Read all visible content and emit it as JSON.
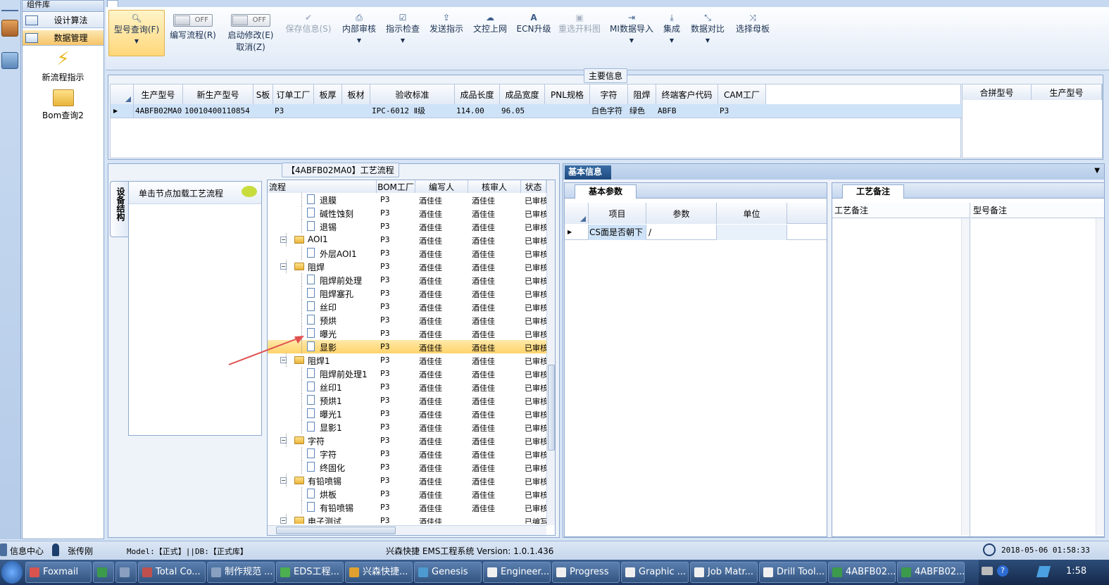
{
  "nav": {
    "top_label": "组件库",
    "items": [
      {
        "label": "设计算法"
      },
      {
        "label": "数据管理"
      }
    ],
    "big_items": [
      {
        "label": "新流程指示",
        "icon": "lightning-icon"
      },
      {
        "label": "Bom查询2",
        "icon": "folder-open-icon"
      }
    ]
  },
  "ribbon": {
    "buttons": [
      {
        "label": "型号查询(F)",
        "icon": "search-icon"
      },
      {
        "label": "编写流程(R)",
        "toggle": "OFF"
      },
      {
        "label": "启动修改(E)",
        "label2": "取消(Z)",
        "toggle": "OFF"
      },
      {
        "label": "保存信息(S)",
        "icon": "check-icon"
      },
      {
        "label": "内部审核",
        "icon": "printer-icon"
      },
      {
        "label": "指示检查",
        "icon": "checkbox-icon"
      },
      {
        "label": "发送指示",
        "icon": "upload-icon"
      },
      {
        "label": "文控上网",
        "icon": "cloud-upload-icon"
      },
      {
        "label": "ECN升级",
        "icon": "font-icon"
      },
      {
        "label": "重选开料图",
        "icon": "image-icon"
      },
      {
        "label": "MI数据导入",
        "icon": "sign-in-icon"
      },
      {
        "label": "集成",
        "icon": "download-icon"
      },
      {
        "label": "数据对比",
        "icon": "compress-icon"
      },
      {
        "label": "选择母板",
        "icon": "shuffle-icon"
      }
    ]
  },
  "main_info": {
    "title": "主要信息",
    "columns": [
      "生产型号",
      "新生产型号",
      "S板",
      "订单工厂",
      "板厚",
      "板材",
      "验收标准",
      "成品长度",
      "成品宽度",
      "PNL规格",
      "字符",
      "阻焊",
      "终端客户代码",
      "CAM工厂"
    ],
    "row": [
      "4ABFB02MA0",
      "10010400110854",
      "",
      "P3",
      "",
      "",
      "IPC-6012 Ⅱ级",
      "114.00",
      "96.05",
      "",
      "白色字符",
      "绿色",
      "ABFB",
      "P3"
    ],
    "side_columns": [
      "合拼型号",
      "生产型号"
    ]
  },
  "process": {
    "title": "【4ABFB02MA0】工艺流程",
    "vtab": "设备结构",
    "hint": "单击节点加载工艺流程",
    "columns": [
      "流程",
      "BOM工厂",
      "编写人",
      "核审人",
      "状态"
    ],
    "rows": [
      {
        "name": "退膜",
        "level": 2,
        "type": "file",
        "bom": "P3",
        "writer": "酒佳佳",
        "reviewer": "酒佳佳",
        "status": "已审核"
      },
      {
        "name": "碱性蚀刻",
        "level": 2,
        "type": "file",
        "bom": "P3",
        "writer": "酒佳佳",
        "reviewer": "酒佳佳",
        "status": "已审核"
      },
      {
        "name": "退锡",
        "level": 2,
        "type": "file",
        "bom": "P3",
        "writer": "酒佳佳",
        "reviewer": "酒佳佳",
        "status": "已审核"
      },
      {
        "name": "AOI1",
        "level": 1,
        "type": "folder",
        "bom": "P3",
        "writer": "酒佳佳",
        "reviewer": "酒佳佳",
        "status": "已审核"
      },
      {
        "name": "外层AOI1",
        "level": 2,
        "type": "file",
        "bom": "P3",
        "writer": "酒佳佳",
        "reviewer": "酒佳佳",
        "status": "已审核"
      },
      {
        "name": "阻焊",
        "level": 1,
        "type": "folder",
        "bom": "P3",
        "writer": "酒佳佳",
        "reviewer": "酒佳佳",
        "status": "已审核"
      },
      {
        "name": "阻焊前处理",
        "level": 2,
        "type": "file",
        "bom": "P3",
        "writer": "酒佳佳",
        "reviewer": "酒佳佳",
        "status": "已审核"
      },
      {
        "name": "阻焊塞孔",
        "level": 2,
        "type": "file",
        "bom": "P3",
        "writer": "酒佳佳",
        "reviewer": "酒佳佳",
        "status": "已审核"
      },
      {
        "name": "丝印",
        "level": 2,
        "type": "file",
        "bom": "P3",
        "writer": "酒佳佳",
        "reviewer": "酒佳佳",
        "status": "已审核"
      },
      {
        "name": "预烘",
        "level": 2,
        "type": "file",
        "bom": "P3",
        "writer": "酒佳佳",
        "reviewer": "酒佳佳",
        "status": "已审核"
      },
      {
        "name": "曝光",
        "level": 2,
        "type": "file",
        "bom": "P3",
        "writer": "酒佳佳",
        "reviewer": "酒佳佳",
        "status": "已审核"
      },
      {
        "name": "显影",
        "level": 2,
        "type": "file",
        "bom": "P3",
        "writer": "酒佳佳",
        "reviewer": "酒佳佳",
        "status": "已审核",
        "selected": true
      },
      {
        "name": "阻焊1",
        "level": 1,
        "type": "folder",
        "bom": "P3",
        "writer": "酒佳佳",
        "reviewer": "酒佳佳",
        "status": "已审核"
      },
      {
        "name": "阻焊前处理1",
        "level": 2,
        "type": "file",
        "bom": "P3",
        "writer": "酒佳佳",
        "reviewer": "酒佳佳",
        "status": "已审核"
      },
      {
        "name": "丝印1",
        "level": 2,
        "type": "file",
        "bom": "P3",
        "writer": "酒佳佳",
        "reviewer": "酒佳佳",
        "status": "已审核"
      },
      {
        "name": "预烘1",
        "level": 2,
        "type": "file",
        "bom": "P3",
        "writer": "酒佳佳",
        "reviewer": "酒佳佳",
        "status": "已审核"
      },
      {
        "name": "曝光1",
        "level": 2,
        "type": "file",
        "bom": "P3",
        "writer": "酒佳佳",
        "reviewer": "酒佳佳",
        "status": "已审核"
      },
      {
        "name": "显影1",
        "level": 2,
        "type": "file",
        "bom": "P3",
        "writer": "酒佳佳",
        "reviewer": "酒佳佳",
        "status": "已审核"
      },
      {
        "name": "字符",
        "level": 1,
        "type": "folder",
        "bom": "P3",
        "writer": "酒佳佳",
        "reviewer": "酒佳佳",
        "status": "已审核"
      },
      {
        "name": "字符",
        "level": 2,
        "type": "file",
        "bom": "P3",
        "writer": "酒佳佳",
        "reviewer": "酒佳佳",
        "status": "已审核"
      },
      {
        "name": "终固化",
        "level": 2,
        "type": "file",
        "bom": "P3",
        "writer": "酒佳佳",
        "reviewer": "酒佳佳",
        "status": "已审核"
      },
      {
        "name": "有铅喷锡",
        "level": 1,
        "type": "folder",
        "bom": "P3",
        "writer": "酒佳佳",
        "reviewer": "酒佳佳",
        "status": "已审核"
      },
      {
        "name": "烘板",
        "level": 2,
        "type": "file",
        "bom": "P3",
        "writer": "酒佳佳",
        "reviewer": "酒佳佳",
        "status": "已审核"
      },
      {
        "name": "有铅喷锡",
        "level": 2,
        "type": "file",
        "bom": "P3",
        "writer": "酒佳佳",
        "reviewer": "酒佳佳",
        "status": "已审核"
      },
      {
        "name": "电子测试",
        "level": 1,
        "type": "folder",
        "bom": "P3",
        "writer": "酒佳佳",
        "reviewer": "",
        "status": "已编写"
      },
      {
        "name": "电子测试",
        "level": 2,
        "type": "file",
        "bom": "P3",
        "writer": "酒佳佳",
        "reviewer": "",
        "status": "已编写"
      }
    ]
  },
  "basic_info": {
    "title": "基本信息",
    "params_tab": "基本参数",
    "param_columns": [
      "项目",
      "参数",
      "单位"
    ],
    "param_rows": [
      {
        "item": "CS面是否朝下",
        "value": "/",
        "unit": ""
      }
    ],
    "notes_tab": "工艺备注",
    "notes_columns": [
      "工艺备注",
      "型号备注"
    ]
  },
  "statusbar": {
    "info_center": "信息中心",
    "user": "张传刚",
    "model": "Model:【正式】||DB:【正式库】",
    "system": "兴森快捷 EMS工程系统 Version: 1.0.1.436",
    "datetime": "2018-05-06 01:58:33"
  },
  "taskbar": {
    "items": [
      {
        "label": "Foxmail",
        "color": "#d9534f"
      },
      {
        "label": "",
        "color": "#3c9a4c"
      },
      {
        "label": "",
        "color": "#8aa0c0"
      },
      {
        "label": "Total Co...",
        "color": "#c0504d"
      },
      {
        "label": "制作规范 ...",
        "color": "#8aa0c0"
      },
      {
        "label": "EDS工程...",
        "color": "#4caf50"
      },
      {
        "label": "兴森快捷...",
        "color": "#e0a030"
      },
      {
        "label": "Genesis",
        "color": "#4c9ad0"
      },
      {
        "label": "Engineer...",
        "color": "#f0f0f0"
      },
      {
        "label": "Progress",
        "color": "#f0f0f0"
      },
      {
        "label": "Graphic ...",
        "color": "#f0f0f0"
      },
      {
        "label": "Job Matr...",
        "color": "#f0f0f0"
      },
      {
        "label": "Drill Tool...",
        "color": "#f0f0f0"
      },
      {
        "label": "4ABFB02...",
        "color": "#3c9a4c"
      },
      {
        "label": "4ABFB02...",
        "color": "#3c9a4c"
      }
    ],
    "clock": "1:58"
  }
}
